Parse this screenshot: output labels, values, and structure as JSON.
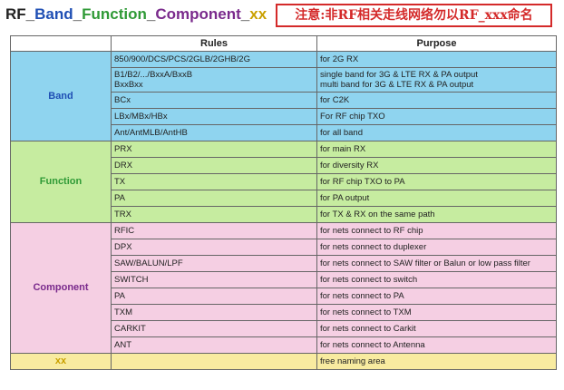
{
  "title": {
    "rf": "RF",
    "sep": "_",
    "band": "Band",
    "function": "Function",
    "component": "Component",
    "xx": "xx"
  },
  "note": "注意:非RF相关走线网络勿以RF_xxx命名",
  "table": {
    "headers": {
      "category": "",
      "rules": "Rules",
      "purpose": "Purpose"
    },
    "groups": {
      "band": {
        "label": "Band",
        "rows": [
          {
            "rule": "850/900/DCS/PCS/2GLB/2GHB/2G",
            "purpose": "for 2G RX"
          },
          {
            "rule": "B1/B2/.../BxxA/BxxB",
            "rule2": "BxxBxx",
            "purpose": "single band for 3G & LTE RX & PA output",
            "purpose2": "multi band for 3G & LTE RX & PA output"
          },
          {
            "rule": "BCx",
            "purpose": "for C2K"
          },
          {
            "rule": "LBx/MBx/HBx",
            "purpose": "For RF chip TXO"
          },
          {
            "rule": "Ant/AntMLB/AntHB",
            "purpose": "for all band"
          }
        ]
      },
      "function": {
        "label": "Function",
        "rows": [
          {
            "rule": "PRX",
            "purpose": "for main RX"
          },
          {
            "rule": "DRX",
            "purpose": "for diversity RX"
          },
          {
            "rule": "TX",
            "purpose": "for RF chip TXO to PA"
          },
          {
            "rule": "PA",
            "purpose": "for PA output"
          },
          {
            "rule": "TRX",
            "purpose": "for TX & RX on the same path"
          }
        ]
      },
      "component": {
        "label": "Component",
        "rows": [
          {
            "rule": "RFIC",
            "purpose": "for nets connect to RF chip"
          },
          {
            "rule": "DPX",
            "purpose": "for nets connect to duplexer"
          },
          {
            "rule": "SAW/BALUN/LPF",
            "purpose": "for nets connect to SAW filter or Balun or low pass filter"
          },
          {
            "rule": "SWITCH",
            "purpose": "for nets connect to switch"
          },
          {
            "rule": "PA",
            "purpose": "for nets connect to PA"
          },
          {
            "rule": "TXM",
            "purpose": "for nets connect to TXM"
          },
          {
            "rule": "CARKIT",
            "purpose": "for nets connect to Carkit"
          },
          {
            "rule": "ANT",
            "purpose": "for nets connect to Antenna"
          }
        ]
      },
      "xx": {
        "label": "xx",
        "rows": [
          {
            "rule": "",
            "purpose": "free naming area"
          }
        ]
      }
    }
  },
  "colors": {
    "band_bg": "#8fd4ef",
    "function_bg": "#c6eca0",
    "component_bg": "#f5cfe3",
    "xx_bg": "#f8eba0",
    "note_border": "#d42a2a"
  }
}
